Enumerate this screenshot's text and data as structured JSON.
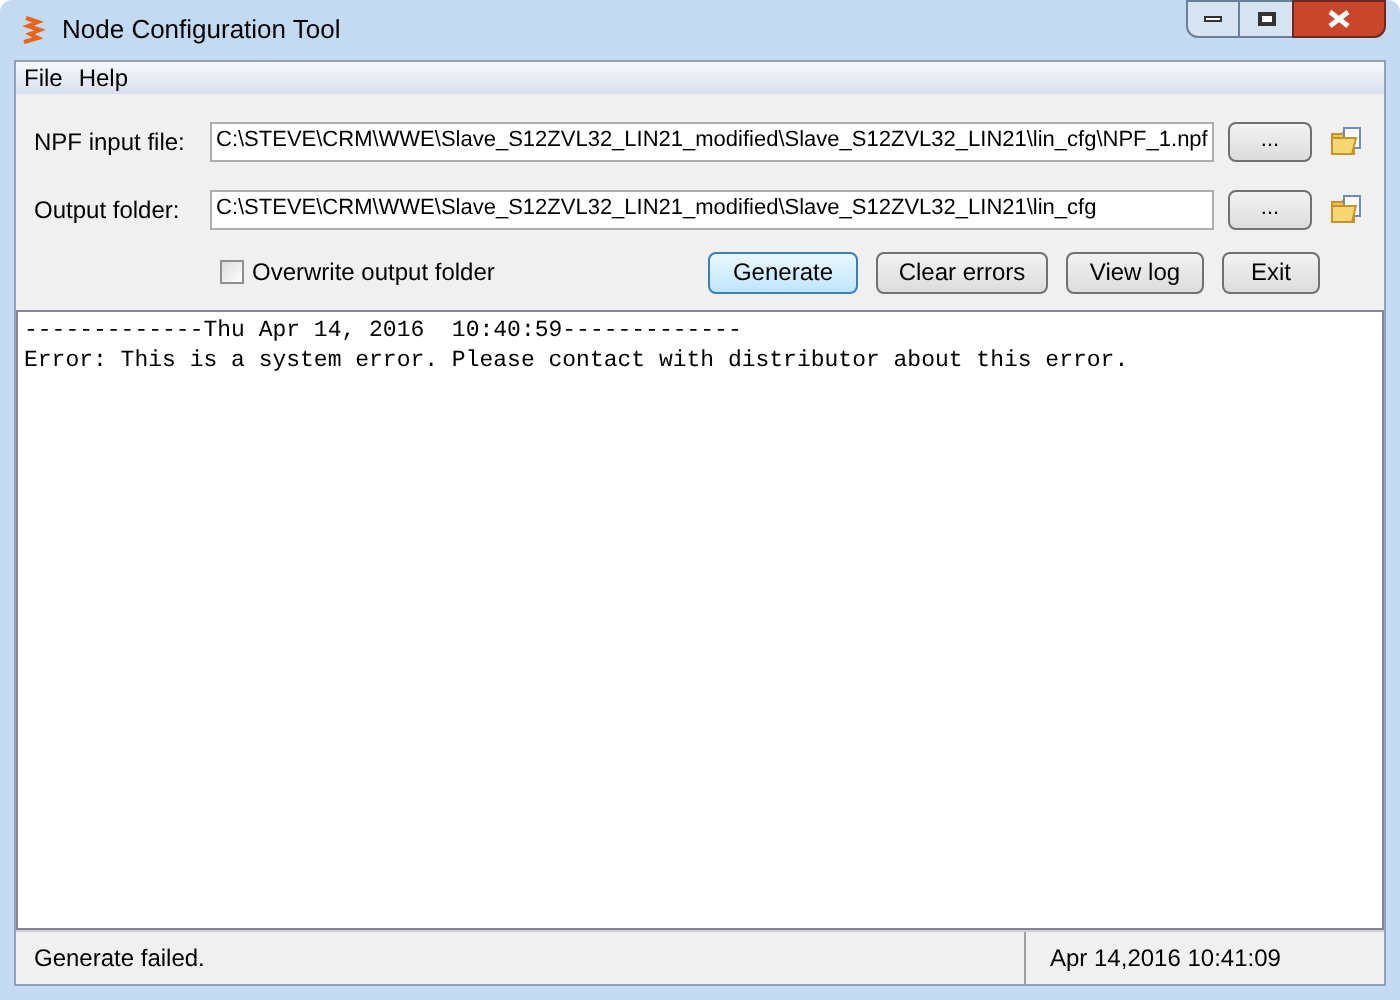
{
  "window": {
    "title": "Node Configuration Tool"
  },
  "menu": [
    "File",
    "Help"
  ],
  "fields": [
    {
      "label": "NPF input file:",
      "value": "C:\\STEVE\\CRM\\WWE\\Slave_S12ZVL32_LIN21_modified\\Slave_S12ZVL32_LIN21\\lin_cfg\\NPF_1.npf",
      "browse": "..."
    },
    {
      "label": "Output folder:",
      "value": "C:\\STEVE\\CRM\\WWE\\Slave_S12ZVL32_LIN21_modified\\Slave_S12ZVL32_LIN21\\lin_cfg",
      "browse": "..."
    }
  ],
  "overwrite": {
    "label": "Overwrite output folder",
    "checked": false
  },
  "buttons": [
    {
      "label": "Generate",
      "selected": true
    },
    {
      "label": "Clear errors",
      "selected": false
    },
    {
      "label": "View log",
      "selected": false
    },
    {
      "label": "Exit",
      "selected": false
    }
  ],
  "log": [
    "-------------Thu Apr 14, 2016  10:40:59-------------",
    "Error: This is a system error. Please contact with distributor about this error."
  ],
  "status_bar": {
    "message": "Generate failed.",
    "time": "Apr 14,2016 10:41:09"
  }
}
